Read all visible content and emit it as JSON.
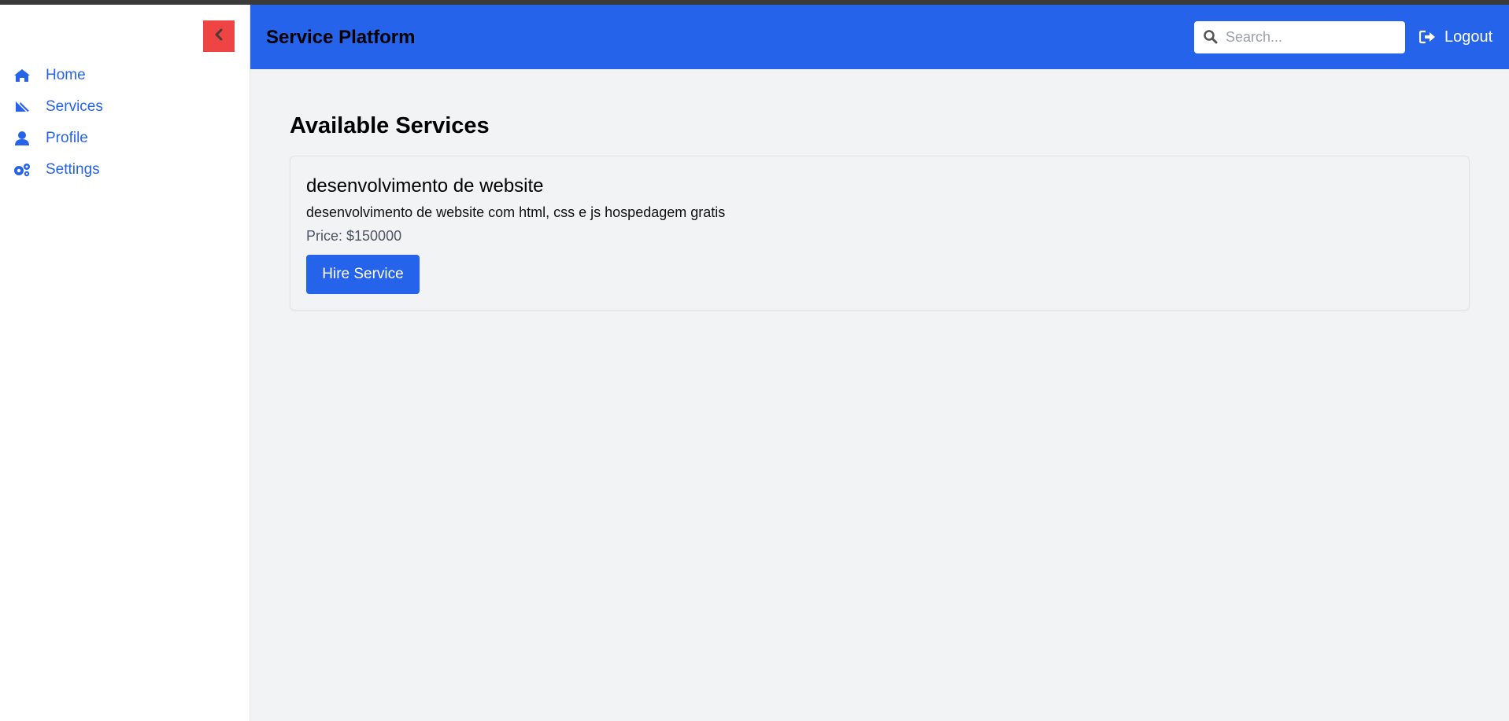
{
  "app": {
    "title": "Service Platform"
  },
  "sidebar": {
    "collapse_icon": "chevron-left-icon",
    "items": [
      {
        "label": "Home",
        "icon": "home-icon"
      },
      {
        "label": "Services",
        "icon": "service-icon"
      },
      {
        "label": "Profile",
        "icon": "user-icon"
      },
      {
        "label": "Settings",
        "icon": "gears-icon"
      }
    ]
  },
  "header": {
    "search": {
      "placeholder": "Search...",
      "value": "",
      "icon": "search-icon"
    },
    "logout_label": "Logout",
    "logout_icon": "sign-out-icon"
  },
  "main": {
    "title": "Available Services",
    "services": [
      {
        "name": "desenvolvimento de website",
        "description": "desenvolvimento de website com html, css e js hospedagem gratis",
        "price": "Price: $150000",
        "button_label": "Hire Service"
      }
    ]
  },
  "colors": {
    "primary": "#2563eb",
    "collapse_button": "#ef4444",
    "background": "#f2f3f5",
    "sidebar": "#ffffff"
  }
}
